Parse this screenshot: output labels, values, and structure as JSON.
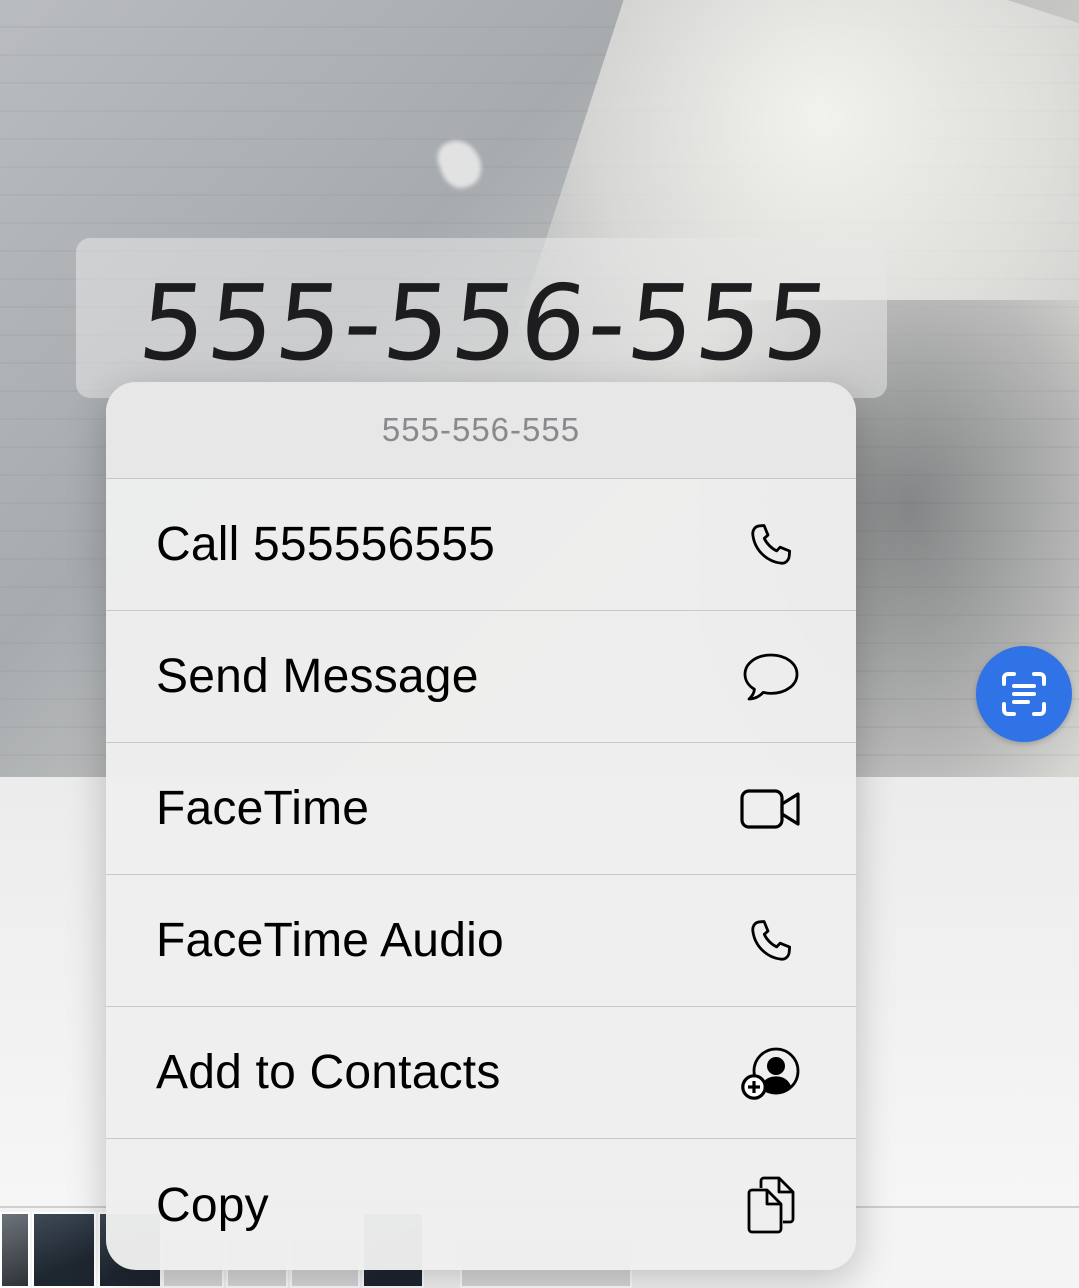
{
  "photo": {
    "recognized_text": "555-556-555"
  },
  "context_menu": {
    "header": "555-556-555",
    "items": [
      {
        "label": "Call 555556555",
        "icon": "phone-icon"
      },
      {
        "label": "Send Message",
        "icon": "message-bubble-icon"
      },
      {
        "label": "FaceTime",
        "icon": "video-camera-icon"
      },
      {
        "label": "FaceTime Audio",
        "icon": "phone-icon"
      },
      {
        "label": "Add to Contacts",
        "icon": "add-contact-icon"
      },
      {
        "label": "Copy",
        "icon": "copy-icon"
      }
    ]
  },
  "live_text_button": {
    "icon": "live-text-icon"
  },
  "colors": {
    "accent_blue": "#2f73e6",
    "menu_background": "#eeeeee",
    "header_text": "#8a8a8e"
  }
}
